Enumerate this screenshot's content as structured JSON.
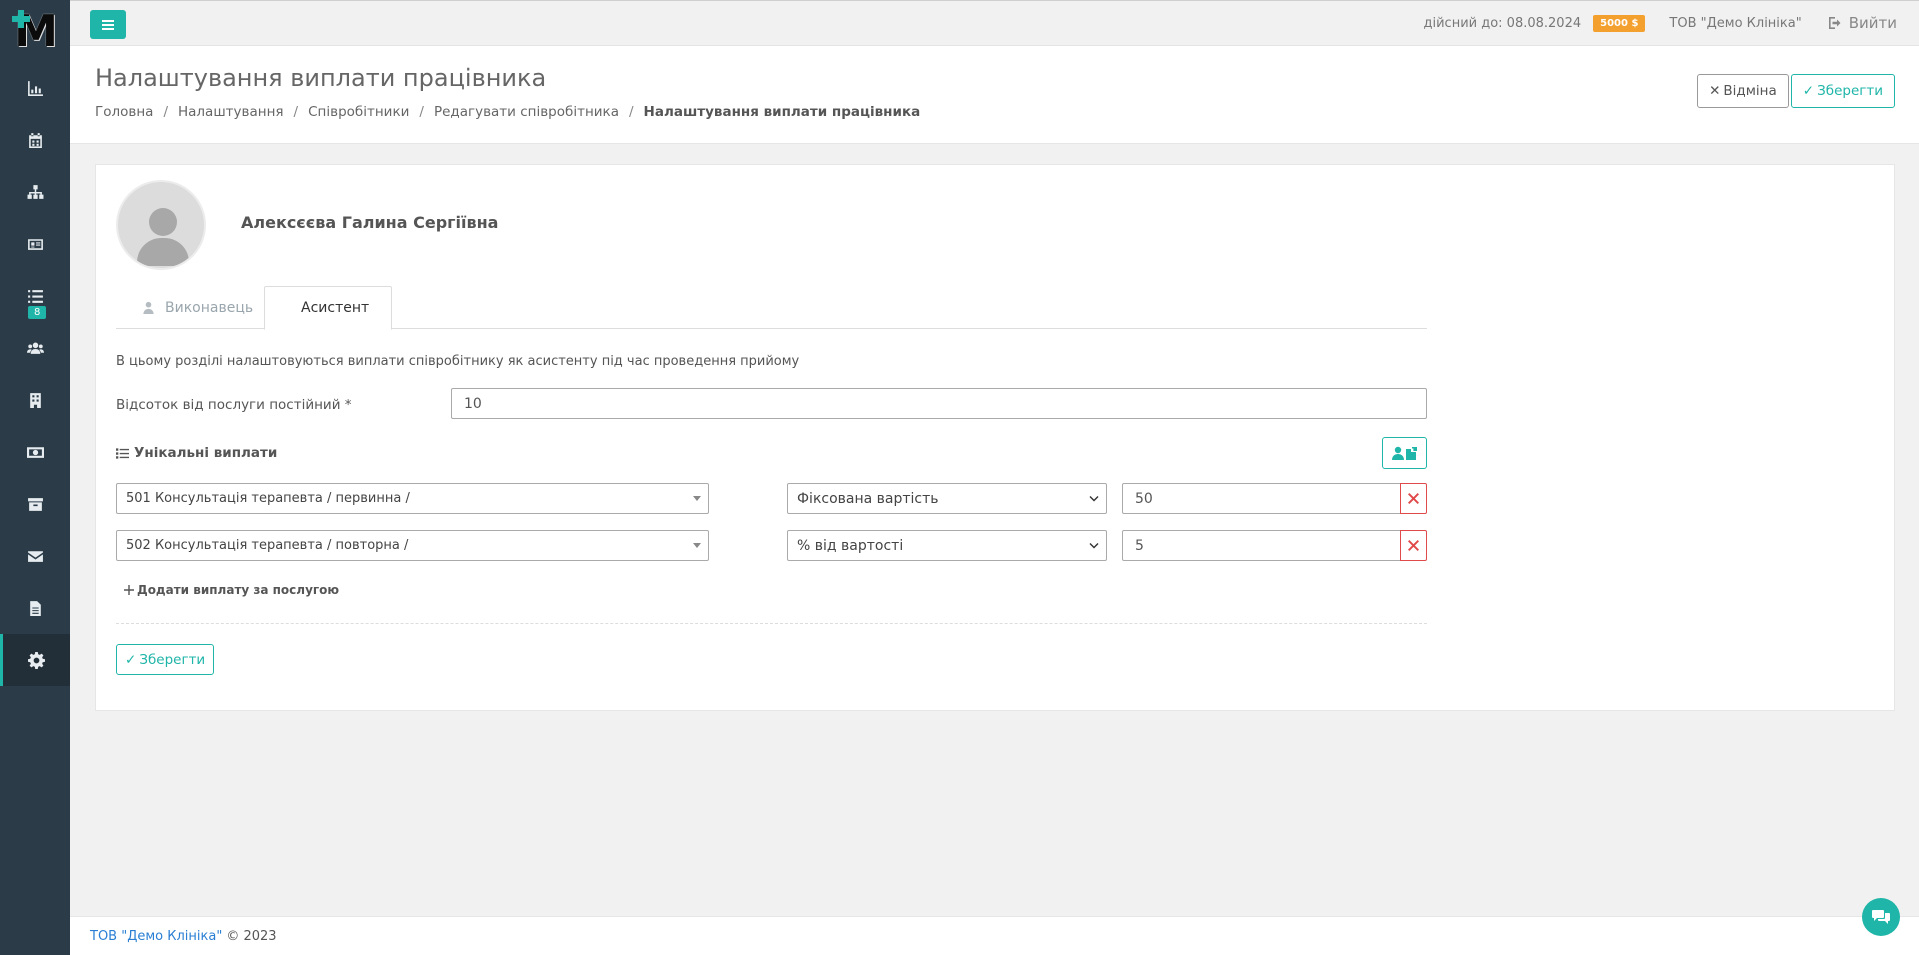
{
  "topbar": {
    "valid_until": "дійсний до: 08.08.2024",
    "balance": "5000 $",
    "company": "ТОВ \"Демо Клініка\"",
    "logout": "Вийти"
  },
  "sidebar": {
    "items": [
      {
        "icon": "chart-icon"
      },
      {
        "icon": "calendar-icon"
      },
      {
        "icon": "sitemap-icon"
      },
      {
        "icon": "id-card-icon"
      },
      {
        "icon": "list-icon",
        "badge": "8"
      },
      {
        "icon": "users-icon"
      },
      {
        "icon": "building-icon"
      },
      {
        "icon": "money-icon"
      },
      {
        "icon": "archive-icon"
      },
      {
        "icon": "envelope-icon"
      },
      {
        "icon": "file-icon"
      },
      {
        "icon": "gear-icon",
        "active": true
      }
    ]
  },
  "header": {
    "title": "Налаштування виплати працівника",
    "breadcrumb": [
      "Головна",
      "Налаштування",
      "Співробітники",
      "Редагувати співробітника",
      "Налаштування виплати працівника"
    ],
    "cancel_label": "Відміна",
    "save_label": "Зберегти"
  },
  "employee": {
    "name": "Алексєєва Галина Сергіївна"
  },
  "tabs": [
    {
      "label": "Виконавець",
      "active": false
    },
    {
      "label": "Асистент",
      "active": true
    }
  ],
  "form": {
    "info": "В цьому розділі налаштовуються виплати співробітнику як асистенту під час проведення прийому",
    "percent_label": "Відсоток від послуги постійний *",
    "percent_value": "10",
    "unique_title": "Унікальні виплати",
    "rows": [
      {
        "service": "501 Консультація терапевта / первинна /",
        "type": "Фіксована вартість",
        "value": "50"
      },
      {
        "service": "502 Консультація терапевта / повторна /",
        "type": "% від вартості",
        "value": "5"
      }
    ],
    "add_label": "Додати виплату за послугою",
    "save_label": "Зберегти"
  },
  "footer": {
    "company": "ТОВ \"Демо Клініка\"",
    "copy": "© 2023"
  },
  "colors": {
    "accent": "#1fb5a8",
    "sidebar": "#2b3b47",
    "badge": "#f4a02e",
    "danger": "#e04a4a"
  }
}
